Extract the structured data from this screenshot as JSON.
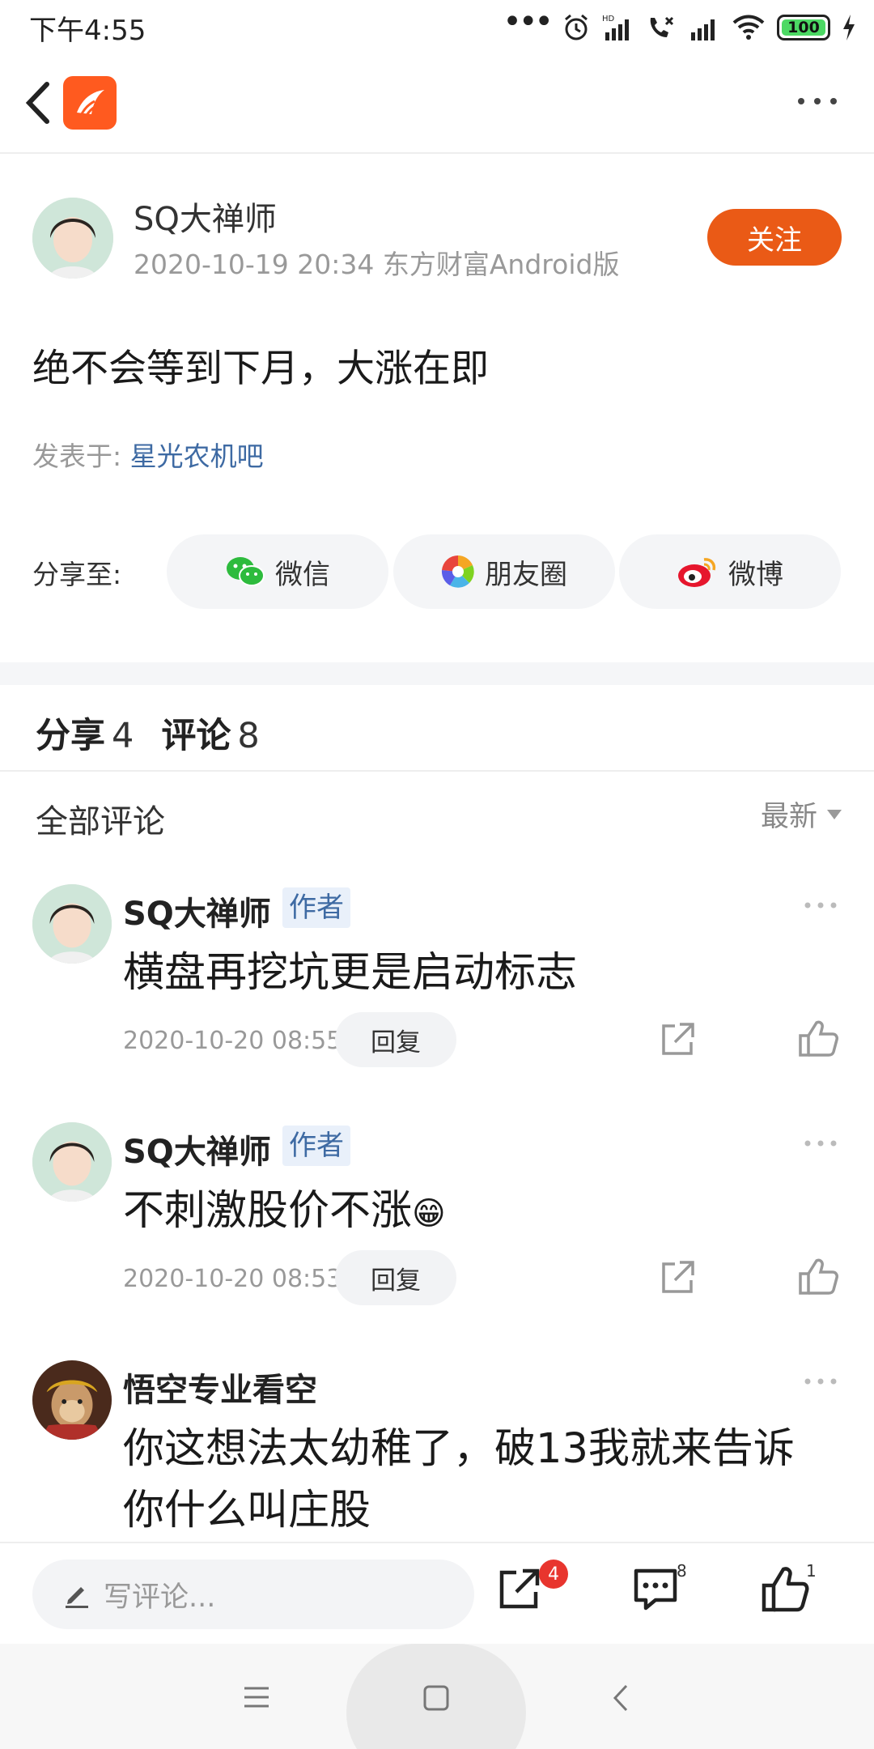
{
  "status_bar": {
    "time": "下午4:55",
    "battery": "100"
  },
  "nav": {
    "back": "back",
    "app_logo": "eastmoney-logo",
    "more": "more"
  },
  "post": {
    "author": "SQ大禅师",
    "meta": "2020-10-19 20:34 东方财富Android版",
    "follow_label": "关注",
    "title": "绝不会等到下月，大涨在即",
    "posted_in_label": "发表于:",
    "board": "星光农机吧",
    "share_label": "分享至:",
    "share_targets": [
      {
        "label": "微信",
        "icon": "wechat-icon"
      },
      {
        "label": "朋友圈",
        "icon": "moments-icon"
      },
      {
        "label": "微博",
        "icon": "weibo-icon"
      }
    ]
  },
  "stats": {
    "share_label": "分享",
    "share_count": "4",
    "comment_label": "评论",
    "comment_count": "8"
  },
  "comments_header": {
    "title": "全部评论",
    "sort": "最新"
  },
  "comments": [
    {
      "name": "SQ大禅师",
      "tag": "作者",
      "text": "横盘再挖坑更是启动标志",
      "date": "2020-10-20 08:55",
      "reply_label": "回复"
    },
    {
      "name": "SQ大禅师",
      "tag": "作者",
      "text": "不刺激股价不涨",
      "emoji": "😁",
      "date": "2020-10-20 08:53",
      "reply_label": "回复"
    },
    {
      "name": "悟空专业看空",
      "tag": "",
      "text": "你这想法太幼稚了，破13我就来告诉你什么叫庄股",
      "date": "",
      "reply_label": ""
    }
  ],
  "bottom_bar": {
    "placeholder": "写评论...",
    "share_badge": "4",
    "comment_count": "8",
    "like_count": "1"
  },
  "colors": {
    "accent": "#ea5a16",
    "link": "#3e6aa3",
    "badge": "#e8352e"
  }
}
